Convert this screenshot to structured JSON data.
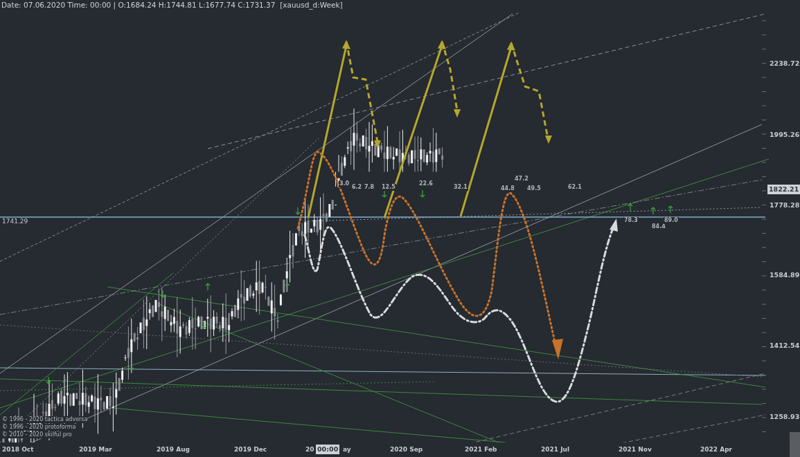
{
  "header": "Date: 07.06.2020 Time: 00:00 | O:1684.24 H:1744.81 L:1677.74 C:1731.37  [xauusd_d:Week]",
  "price_axis": {
    "ticks": [
      "2238.72",
      "1995.26",
      "1778.28",
      "1584.89",
      "1412.54",
      "1258.93"
    ],
    "current_price": "1822.21"
  },
  "price_line": {
    "label": "1741.29"
  },
  "time_axis": {
    "ticks": [
      "2018 Oct",
      "2019 Mar",
      "2019 Aug",
      "2019 Dec",
      "20",
      "2020 Sep",
      "2021 Feb",
      "2021 Jul",
      "2021 Nov",
      "2022 Apr"
    ],
    "cursor_tail": "ay",
    "cursor_time": "00:00"
  },
  "levels": [
    "3.0",
    "6.2",
    "7.8",
    "12.5",
    "22.6",
    "32.1",
    "44.8",
    "47.2",
    "49.5",
    "62.1",
    "78.3",
    "84.4",
    "89.0"
  ],
  "copyright": [
    "© 1996 - 2020 tactica adversa",
    "© 1996 - 2020 protoforma",
    "© 2010 - 2020 skilful pro"
  ]
}
